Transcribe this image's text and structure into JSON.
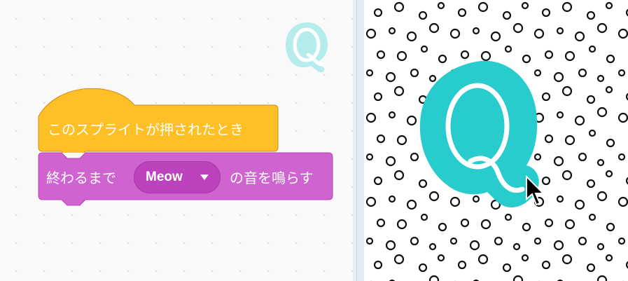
{
  "blocks": {
    "hat_label": "このスプライトが押されたとき",
    "play_prefix": "終わるまで",
    "sound_value": "Meow",
    "play_suffix": "の音を鳴らす"
  },
  "colors": {
    "events_block": "#ffbf26",
    "sound_block": "#cf63cf",
    "sprite_fill": "#29cccc",
    "sprite_thumb": "#b5ecec"
  },
  "icons": [
    "sprite-q-icon",
    "dropdown-caret-icon",
    "mouse-cursor-icon"
  ]
}
